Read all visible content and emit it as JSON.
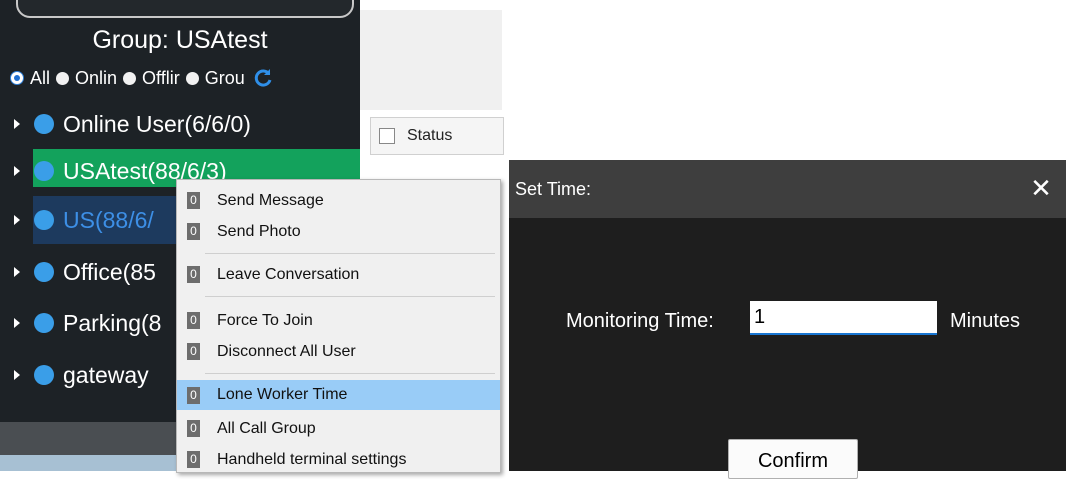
{
  "group_panel": {
    "title": "Group:  USAtest",
    "filters": [
      "All",
      "Onlin",
      "Offlir",
      "Grou"
    ],
    "selected_filter": "All",
    "tree": [
      {
        "label": "Online User(6/6/0)",
        "state": "normal"
      },
      {
        "label": "USAtest(88/6/3)",
        "state": "selected"
      },
      {
        "label": "US(88/6/",
        "state": "hover"
      },
      {
        "label": "Office(85",
        "state": "normal"
      },
      {
        "label": "Parking(8",
        "state": "normal"
      },
      {
        "label": "gateway",
        "state": "normal"
      }
    ]
  },
  "table": {
    "status_header": "Status"
  },
  "context_menu": {
    "items": [
      {
        "num": "0",
        "label": "Send Message"
      },
      {
        "num": "0",
        "label": "Send Photo"
      },
      {
        "num": "0",
        "label": "Leave Conversation"
      },
      {
        "num": "0",
        "label": "Force To Join"
      },
      {
        "num": "0",
        "label": "Disconnect All User"
      },
      {
        "num": "0",
        "label": "Lone Worker Time"
      },
      {
        "num": "0",
        "label": "All Call Group"
      },
      {
        "num": "0",
        "label": "Handheld terminal settings"
      }
    ],
    "active_item": "Lone Worker Time"
  },
  "dialog": {
    "title": "Set Time:",
    "close_icon": "close-icon",
    "monitoring_label": "Monitoring Time:",
    "monitoring_value": "1",
    "unit_label": "Minutes",
    "confirm_label": "Confirm"
  },
  "colors": {
    "panel_bg": "#1d2226",
    "selected_green": "#13a25c",
    "hover_blue": "#1d3a5e",
    "menu_active": "#99ccf7",
    "dialog_bg": "#1e1e1e",
    "dialog_header": "#3e3e3e",
    "accent_blue": "#3a9ee8"
  }
}
